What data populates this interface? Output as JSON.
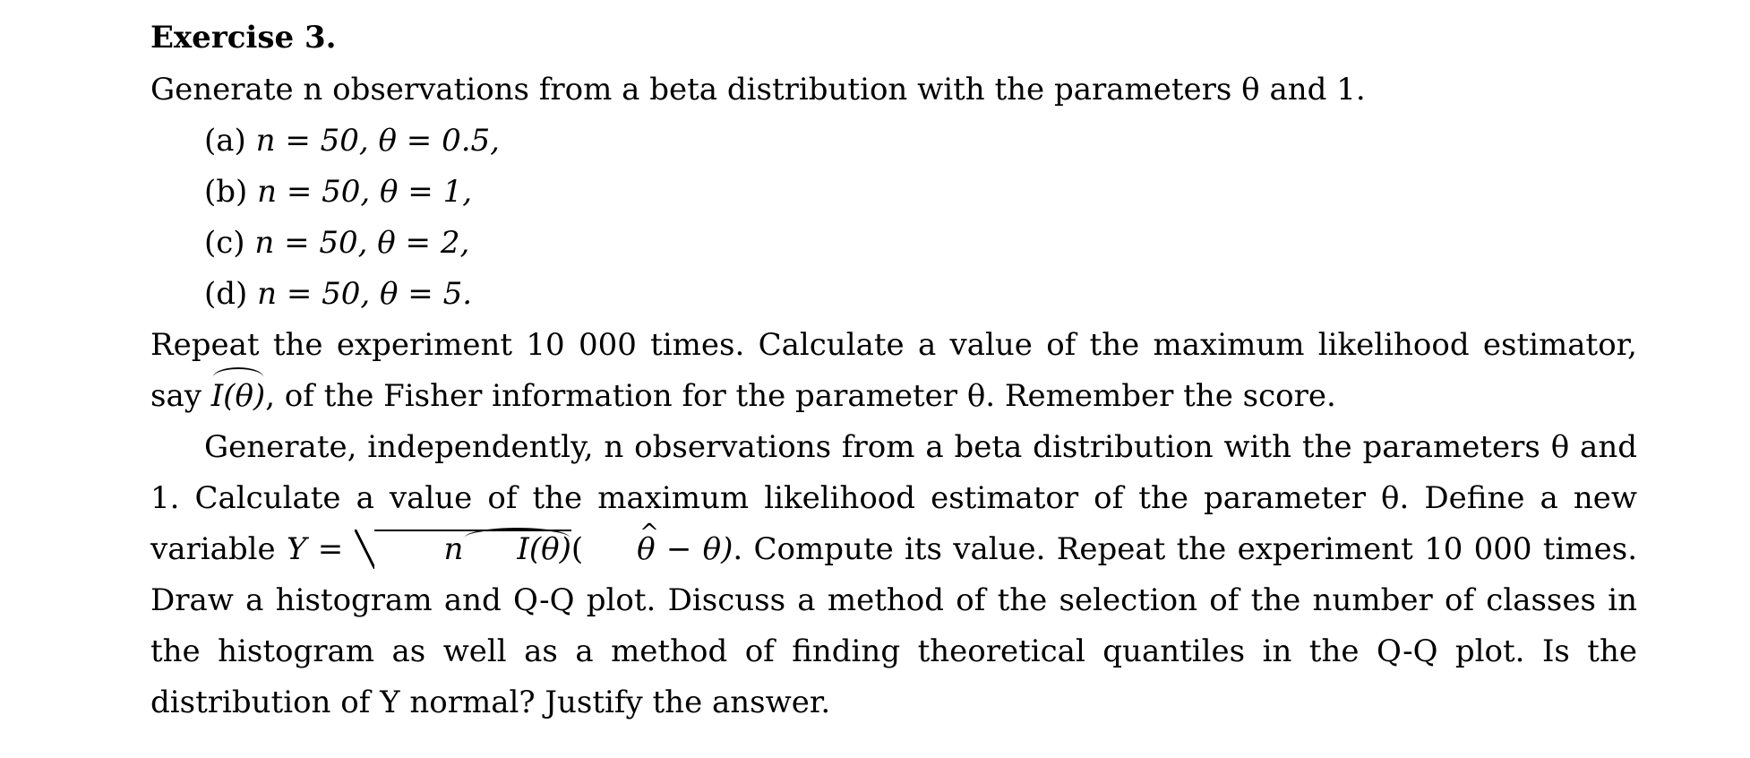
{
  "exercise": {
    "title": "Exercise 3.",
    "intro": "Generate n observations from a beta distribution with the parameters θ and 1.",
    "items": [
      {
        "label": "(a)",
        "text": "n = 50, θ = 0.5,"
      },
      {
        "label": "(b)",
        "text": "n = 50, θ = 1,"
      },
      {
        "label": "(c)",
        "text": "n = 50, θ = 2,"
      },
      {
        "label": "(d)",
        "text": "n = 50, θ = 5."
      }
    ],
    "paragraph1_part1": "Repeat the experiment 10 000 times. Calculate a value of the maximum likelihood estimator, say",
    "paragraph1_hat": "I(θ)",
    "paragraph1_part2": ", of the Fisher information for the parameter θ. Remember the score.",
    "paragraph2_part1": "Generate, independently, n observations from a beta distribution with the parameters θ and 1. Calculate a value of the maximum likelihood estimator of the parameter θ. Define a new variable",
    "paragraph2_y": "Y =",
    "paragraph2_sqrt_n": "n",
    "paragraph2_sqrt_hat": "I(θ)",
    "paragraph2_paren_open": "(",
    "paragraph2_theta_hat": "θ",
    "paragraph2_minus": " − θ)",
    "paragraph2_part2": ". Compute its value. Repeat the experiment 10 000 times. Draw a histogram and Q-Q plot. Discuss a method of the selection of the number of classes in the histogram as well as a method of finding theoretical quantiles in the Q-Q plot. Is the distribution of Y normal? Justify the answer."
  }
}
